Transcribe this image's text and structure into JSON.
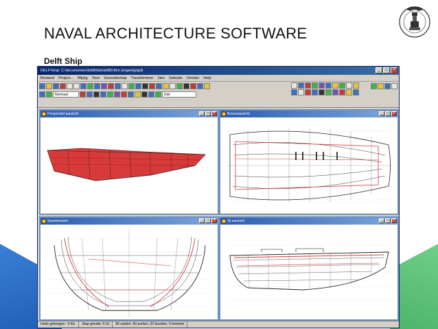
{
  "slide": {
    "title": "NAVAL ARCHITECTURE SOFTWARE",
    "subtitle": "Delft Ship"
  },
  "logo": {
    "icon": "lighthouse-seal-icon",
    "text": "ALEXANDRIA UNIVERSITY"
  },
  "app": {
    "title": "DELFTship: C:\\documenten\\ls880\\lsk\\ls880.fbm (ongewijzigd)",
    "menu": [
      "Bestand",
      "Project...",
      "Wijzig",
      "Toon",
      "Gereedschap",
      "Transformeer",
      "Zien",
      "Selectie",
      "Venster",
      "Help"
    ],
    "toolbar": {
      "select_value": "Normaal",
      "layer_value": "Dek"
    },
    "viewports": [
      {
        "title": "Perspectief aanzicht"
      },
      {
        "title": "Bovenaanzicht"
      },
      {
        "title": "Spantenraam"
      },
      {
        "title": "Zij aanzicht"
      }
    ],
    "status": {
      "undo": "Undo geheugen : 0 Kb.",
      "step": "Stap grootte: 0.10",
      "counts": "90 randen, 60 punten, 20 facetten, 0 kromme"
    }
  },
  "colors": {
    "hull_red": "#d83a3a",
    "title_bar": "#0a246a",
    "accent_blue": "#2f73c9",
    "accent_green": "#4db36d"
  }
}
